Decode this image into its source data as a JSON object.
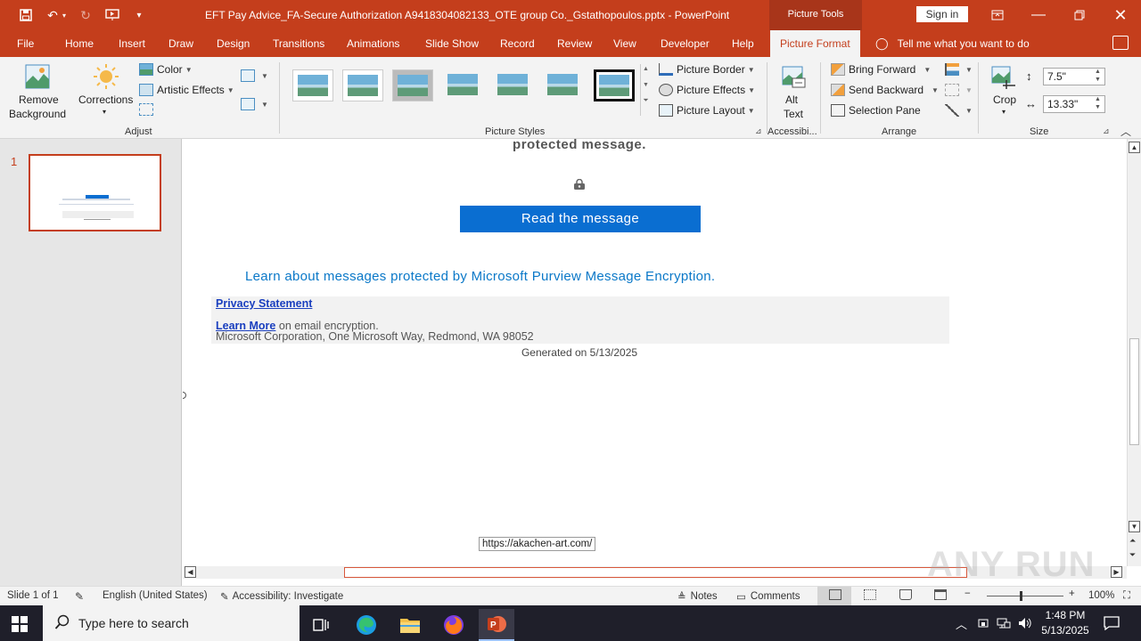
{
  "titlebar": {
    "document_title": "EFT Pay Advice_FA-Secure Authorization A9418304082133_OTE group Co._Gstathopoulos.pptx  -  PowerPoint",
    "context_tab_group": "Picture Tools",
    "sign_in": "Sign in"
  },
  "tabs": [
    "File",
    "Home",
    "Insert",
    "Draw",
    "Design",
    "Transitions",
    "Animations",
    "Slide Show",
    "Record",
    "Review",
    "View",
    "Developer",
    "Help",
    "Picture Format"
  ],
  "active_tab": "Picture Format",
  "tell_me": "Tell me what you want to do",
  "ribbon": {
    "adjust": {
      "label": "Adjust",
      "remove_background": [
        "Remove",
        "Background"
      ],
      "corrections": "Corrections",
      "color": "Color",
      "artistic_effects": "Artistic Effects"
    },
    "picture_styles": {
      "label": "Picture Styles",
      "picture_border": "Picture Border",
      "picture_effects": "Picture Effects",
      "picture_layout": "Picture Layout"
    },
    "accessibility": {
      "label": "Accessibi...",
      "alt_text": [
        "Alt",
        "Text"
      ]
    },
    "arrange": {
      "label": "Arrange",
      "bring_forward": "Bring Forward",
      "send_backward": "Send Backward",
      "selection_pane": "Selection Pane"
    },
    "size": {
      "label": "Size",
      "crop": "Crop",
      "height": "7.5\"",
      "width": "13.33\""
    }
  },
  "slides_panel": {
    "slide_number": "1"
  },
  "slide": {
    "protected_text": "protected message.",
    "read_button": "Read the message",
    "learn_link": "Learn about messages protected by Microsoft Purview Message Encryption.",
    "privacy": "Privacy Statement",
    "learn_more": "Learn More",
    "learn_more_suffix": " on email encryption.",
    "address": "Microsoft Corporation, One Microsoft Way, Redmond, WA 98052",
    "generated": "Generated  on 5/13/2025",
    "url_tooltip": "https://akachen-art.com/"
  },
  "statusbar": {
    "slide_info": "Slide 1 of 1",
    "language": "English (United States)",
    "accessibility": "Accessibility: Investigate",
    "notes": "Notes",
    "comments": "Comments",
    "zoom": "100%"
  },
  "taskbar": {
    "search_placeholder": "Type here to search",
    "time": "1:48 PM",
    "date": "5/13/2025"
  },
  "watermark": "ANY RUN",
  "colors": {
    "accent": "#c43e1c",
    "link_blue": "#0a78c8",
    "button_blue": "#0a6ed1"
  }
}
